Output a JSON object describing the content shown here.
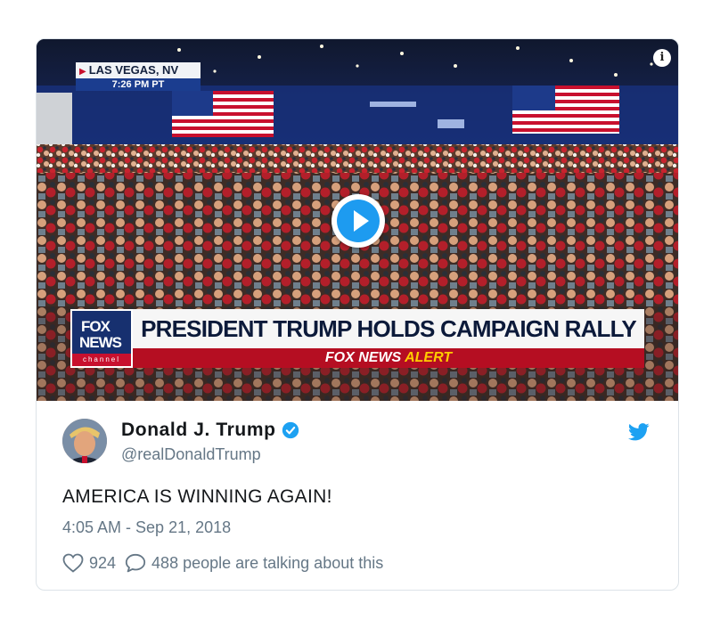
{
  "media": {
    "location": "LAS VEGAS, NV",
    "time": "7:26 PM PT",
    "info_icon": "info-icon",
    "play_icon": "play-icon",
    "channel_logo": {
      "line1": "FOX",
      "line2": "NEWS",
      "line3": "channel"
    },
    "headline": "PRESIDENT TRUMP HOLDS CAMPAIGN RALLY",
    "alert_brand": "FOX NEWS",
    "alert_label": "ALERT",
    "colors": {
      "accent_red": "#b50e22",
      "accent_yellow": "#ffcc00",
      "fox_blue": "#17306f"
    }
  },
  "tweet": {
    "display_name": "Donald J. Trump",
    "handle": "@realDonaldTrump",
    "verified_icon": "verified-badge-icon",
    "platform_icon": "twitter-bird-icon",
    "text": "AMERICA IS WINNING AGAIN!",
    "timestamp": "4:05 AM - Sep 21, 2018",
    "likes": "924",
    "conversation": "488 people are talking about this",
    "colors": {
      "twitter_blue": "#1da1f2",
      "muted_text": "#657786"
    }
  }
}
